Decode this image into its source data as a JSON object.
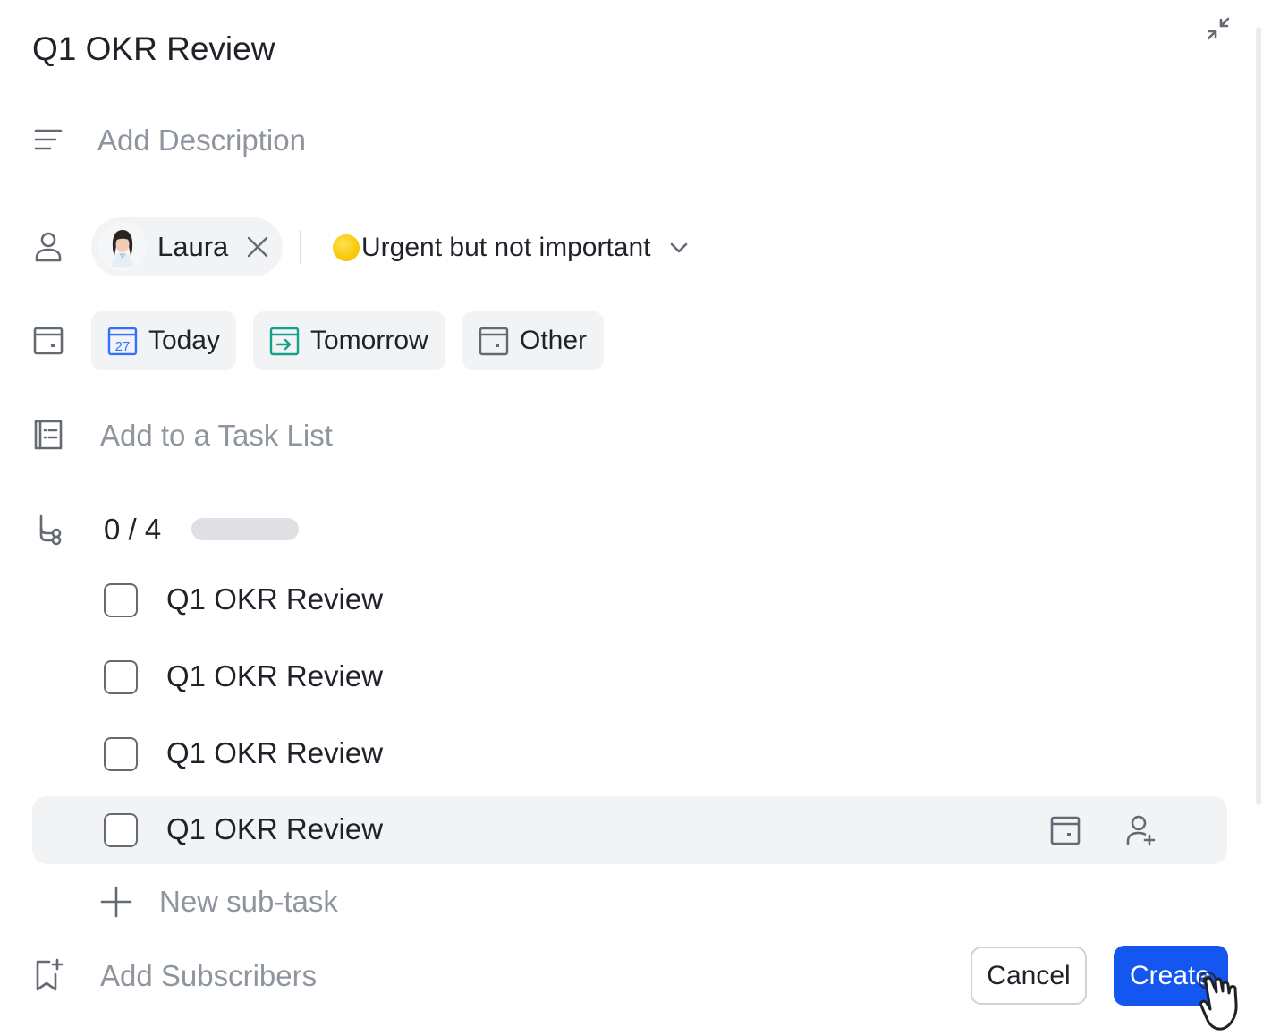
{
  "task": {
    "title": "Q1 OKR Review",
    "description_placeholder": "Add Description"
  },
  "assignee": {
    "name": "Laura",
    "priority_label": "Urgent but not important",
    "priority_color": "#f7c600"
  },
  "due_date": {
    "options": [
      {
        "label": "Today",
        "icon": "calendar-27-icon",
        "day_number": "27",
        "color": "#3370ff"
      },
      {
        "label": "Tomorrow",
        "icon": "calendar-arrow-icon",
        "color": "#14a18a"
      },
      {
        "label": "Other",
        "icon": "calendar-icon",
        "color": "#646a73"
      }
    ]
  },
  "task_list": {
    "placeholder": "Add to a Task List"
  },
  "subtasks": {
    "progress_text": "0 / 4",
    "completed": 0,
    "total": 4,
    "items": [
      {
        "label": "Q1 OKR Review",
        "checked": false
      },
      {
        "label": "Q1 OKR Review",
        "checked": false
      },
      {
        "label": "Q1 OKR Review",
        "checked": false
      },
      {
        "label": "Q1 OKR Review",
        "checked": false
      }
    ],
    "new_label": "New sub-task"
  },
  "subscribers": {
    "placeholder": "Add Subscribers"
  },
  "footer": {
    "cancel_label": "Cancel",
    "create_label": "Create"
  },
  "colors": {
    "primary": "#1456f0",
    "placeholder_text": "#8f959e",
    "chip_bg": "#f2f3f5"
  }
}
